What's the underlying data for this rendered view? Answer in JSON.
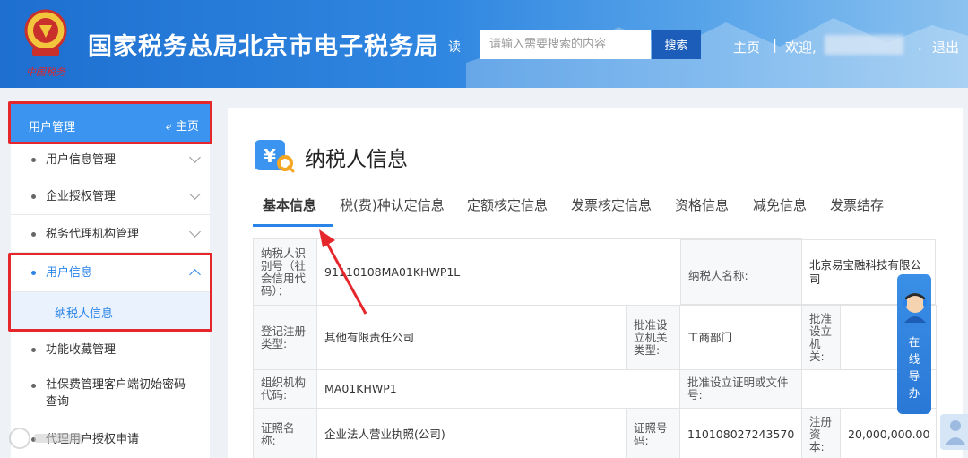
{
  "header": {
    "site_title": "国家税务总局北京市电子税务局",
    "read_label": "读",
    "search_placeholder": "请输入需要搜索的内容",
    "search_button": "搜索",
    "nav_home": "主页",
    "nav_separator": "|",
    "nav_welcome": "欢迎,",
    "nav_dot": ".",
    "nav_logout": "退出",
    "logo_text": "中国税务"
  },
  "sidebar": {
    "head_title": "用户管理",
    "head_home": "主页",
    "items": [
      {
        "label": "用户信息管理"
      },
      {
        "label": "企业授权管理"
      },
      {
        "label": "税务代理机构管理"
      },
      {
        "label": "用户信息"
      },
      {
        "label": "功能收藏管理"
      },
      {
        "label": "社保费管理客户端初始密码查询"
      },
      {
        "label": "代理用户授权申请"
      }
    ],
    "sub_item": "纳税人信息"
  },
  "main": {
    "title": "纳税人信息",
    "tabs": [
      "基本信息",
      "税(费)种认定信息",
      "定额核定信息",
      "发票核定信息",
      "资格信息",
      "减免信息",
      "发票结存"
    ],
    "table": {
      "r1": {
        "label1": "纳税人识别号（社会信用代码）：",
        "value1": "91110108MA01KHWP1L",
        "label2": "纳税人名称:",
        "value2": "北京易宝融科技有限公司"
      },
      "r2": {
        "label1": "登记注册类型:",
        "value1": "其他有限责任公司",
        "label2": "批准设立机关类型:",
        "value2": "工商部门",
        "label3": "批准设立机关:",
        "value3": ""
      },
      "r3": {
        "label1": "组织机构代码:",
        "value1": "MA01KHWP1",
        "label2": "批准设立证明或文件号:",
        "value2": ""
      },
      "r4": {
        "label1": "证照名称:",
        "value1": "企业法人营业执照(公司)",
        "label2": "证照号码:",
        "value2": "110108027243570",
        "label3": "注册资本:",
        "value3": "20,000,000.00"
      }
    }
  },
  "assistant": {
    "label": "在线导办"
  },
  "colors": {
    "header_blue": "#2f86e0",
    "sidebar_head": "#3b94ef",
    "accent": "#2a84e8",
    "annotation_red": "#e5262b"
  }
}
